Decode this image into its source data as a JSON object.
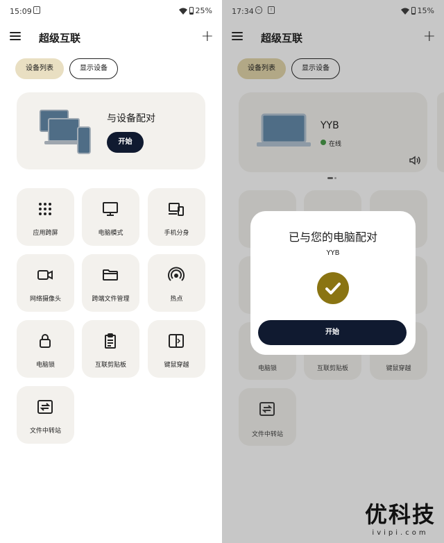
{
  "left": {
    "status": {
      "time": "15:09",
      "battery": "25%"
    },
    "app_title": "超级互联",
    "tabs": [
      "设备列表",
      "显示设备"
    ],
    "pair_card": {
      "title": "与设备配对",
      "button": "开始"
    },
    "grid": [
      {
        "label": "应用跨屏",
        "icon": "app-grid-icon"
      },
      {
        "label": "电脑模式",
        "icon": "monitor-icon"
      },
      {
        "label": "手机分身",
        "icon": "devices-icon"
      },
      {
        "label": "网络摄像头",
        "icon": "camera-icon"
      },
      {
        "label": "跨端文件管理",
        "icon": "folder-icon"
      },
      {
        "label": "热点",
        "icon": "hotspot-icon"
      },
      {
        "label": "电脑锁",
        "icon": "lock-icon"
      },
      {
        "label": "互联剪贴板",
        "icon": "clipboard-icon"
      },
      {
        "label": "键鼠穿越",
        "icon": "keyboard-mouse-icon"
      },
      {
        "label": "文件中转站",
        "icon": "transfer-icon"
      }
    ]
  },
  "right": {
    "status": {
      "time": "17:34",
      "battery": "15%"
    },
    "app_title": "超级互联",
    "tabs": [
      "设备列表",
      "显示设备"
    ],
    "device": {
      "name": "YYB",
      "status": "在线"
    },
    "bottom_labels": [
      "电脑锁",
      "互联剪贴板",
      "键鼠穿越"
    ],
    "last_item": "文件中转站",
    "dialog": {
      "title": "已与您的电脑配对",
      "device": "YYB",
      "button": "开始"
    }
  },
  "watermark": {
    "brand": "优科技",
    "site": "ivipi.com"
  }
}
